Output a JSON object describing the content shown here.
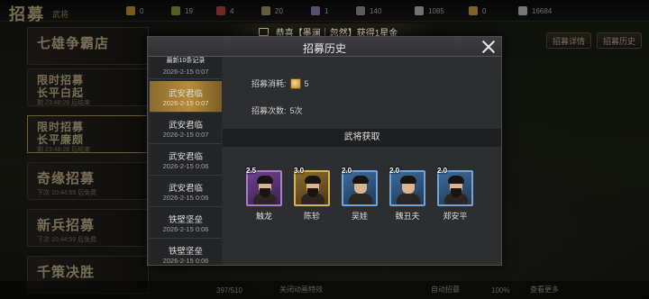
{
  "topbar": {
    "logo": "招募",
    "logo_sub": "武将",
    "resources": [
      {
        "icon": "gold-ingot-icon",
        "value": "0",
        "color": "#d6a63a"
      },
      {
        "icon": "grain-icon",
        "value": "19",
        "color": "#8fb34a"
      },
      {
        "icon": "jade-icon",
        "value": "4",
        "color": "#c84a4a"
      },
      {
        "icon": "scroll-icon",
        "value": "20",
        "color": "#b9a77a"
      },
      {
        "icon": "token-icon",
        "value": "1",
        "color": "#a78cd0"
      },
      {
        "icon": "book-icon",
        "value": "140",
        "color": "#9aa6b2"
      },
      {
        "icon": "sword-icon",
        "value": "1085",
        "color": "#cfcfcf"
      },
      {
        "icon": "coin-icon",
        "value": "0",
        "color": "#e0b64a"
      },
      {
        "icon": "silver-icon",
        "value": "16684",
        "color": "#d8d8d8"
      }
    ]
  },
  "left_recruits": [
    {
      "title": "七雄争霸店",
      "sub": ""
    },
    {
      "title": "限时招募",
      "title2": "长平白起",
      "sub": "剩 23:48:28 后结束"
    },
    {
      "title": "限时招募",
      "title2": "长平廉颇",
      "sub": "剩 23:48:28 后结束"
    },
    {
      "title": "奇缘招募",
      "sub": "下次 10:44:59 后免费"
    },
    {
      "title": "新兵招募",
      "sub": "下次 10:44:59 后免费"
    },
    {
      "title": "千策决胜",
      "sub": ""
    }
  ],
  "right_buttons": [
    "招募详情",
    "招募历史"
  ],
  "bottom": {
    "count": "397/510",
    "skip_anim": "关闭动画特效",
    "auto_recruit": "自动招募",
    "amount": "100%",
    "more": "查看更多"
  },
  "marquee": {
    "text": "恭喜【墨澜｜忽然】获得1星金"
  },
  "modal": {
    "title": "招募历史",
    "sidebar_caption": "最新10条记录",
    "records": [
      {
        "name": "",
        "date": "2026-2-15 0:07",
        "partial": true
      },
      {
        "name": "武安君临",
        "date": "2026-2-15 0:07",
        "active": true
      },
      {
        "name": "武安君临",
        "date": "2026-2-15 0:07"
      },
      {
        "name": "武安君临",
        "date": "2026-2-15 0:06"
      },
      {
        "name": "武安君临",
        "date": "2026-2-15 0:06"
      },
      {
        "name": "铁壁坚垒",
        "date": "2026-2-15 0:06"
      },
      {
        "name": "铁壁坚垒",
        "date": "2026-2-15 0:06"
      }
    ],
    "cost_label": "招募消耗:",
    "cost_value": "5",
    "times_label": "招募次数:",
    "times_value": "5次",
    "section_title": "武将获取",
    "generals": [
      {
        "name": "触龙",
        "rating": "2.5",
        "quality": "purple",
        "beard": true
      },
      {
        "name": "陈轸",
        "rating": "3.0",
        "quality": "gold",
        "beard": true
      },
      {
        "name": "吴娃",
        "rating": "2.0",
        "quality": "blue",
        "beard": false
      },
      {
        "name": "魏丑夫",
        "rating": "2.0",
        "quality": "blue",
        "beard": false
      },
      {
        "name": "郑安平",
        "rating": "2.0",
        "quality": "blue",
        "beard": true
      }
    ]
  }
}
